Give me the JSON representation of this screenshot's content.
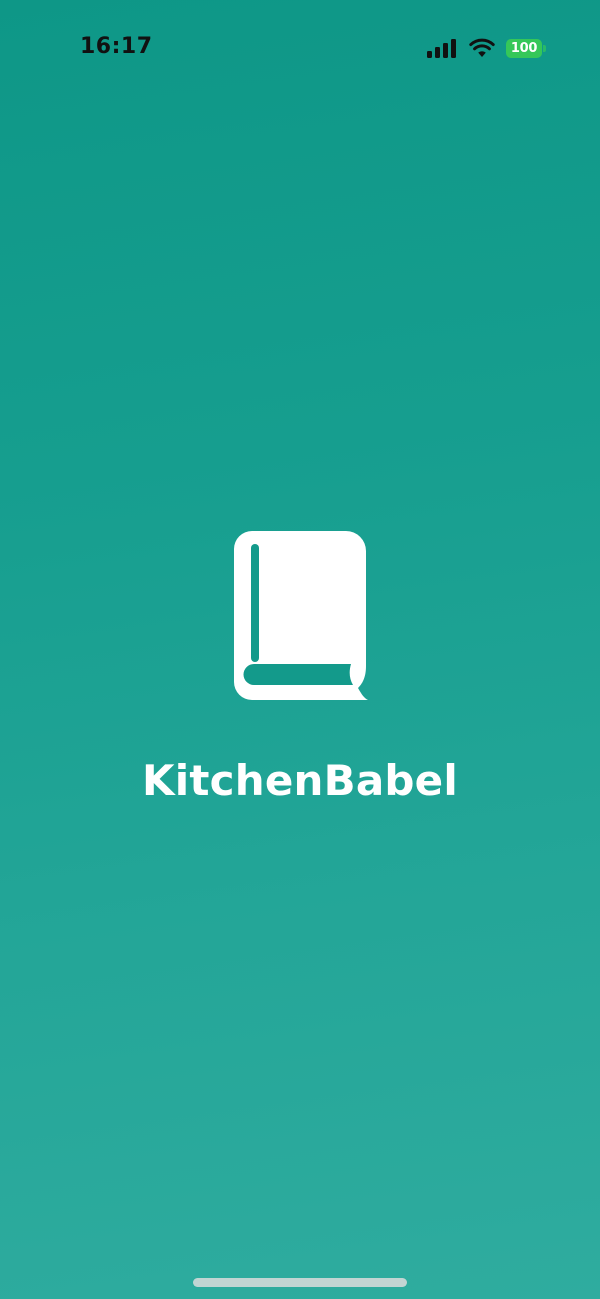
{
  "status_bar": {
    "time": "16:17",
    "battery_level": "100",
    "icons": [
      "signal-icon",
      "wifi-icon",
      "battery-icon"
    ],
    "battery_color": "#35c759"
  },
  "splash": {
    "logo_icon": "book-icon",
    "app_name": "KitchenBabel",
    "background_top_color": "#0e9787",
    "background_bottom_color": "#2fac9f",
    "foreground_color": "#ffffff"
  }
}
